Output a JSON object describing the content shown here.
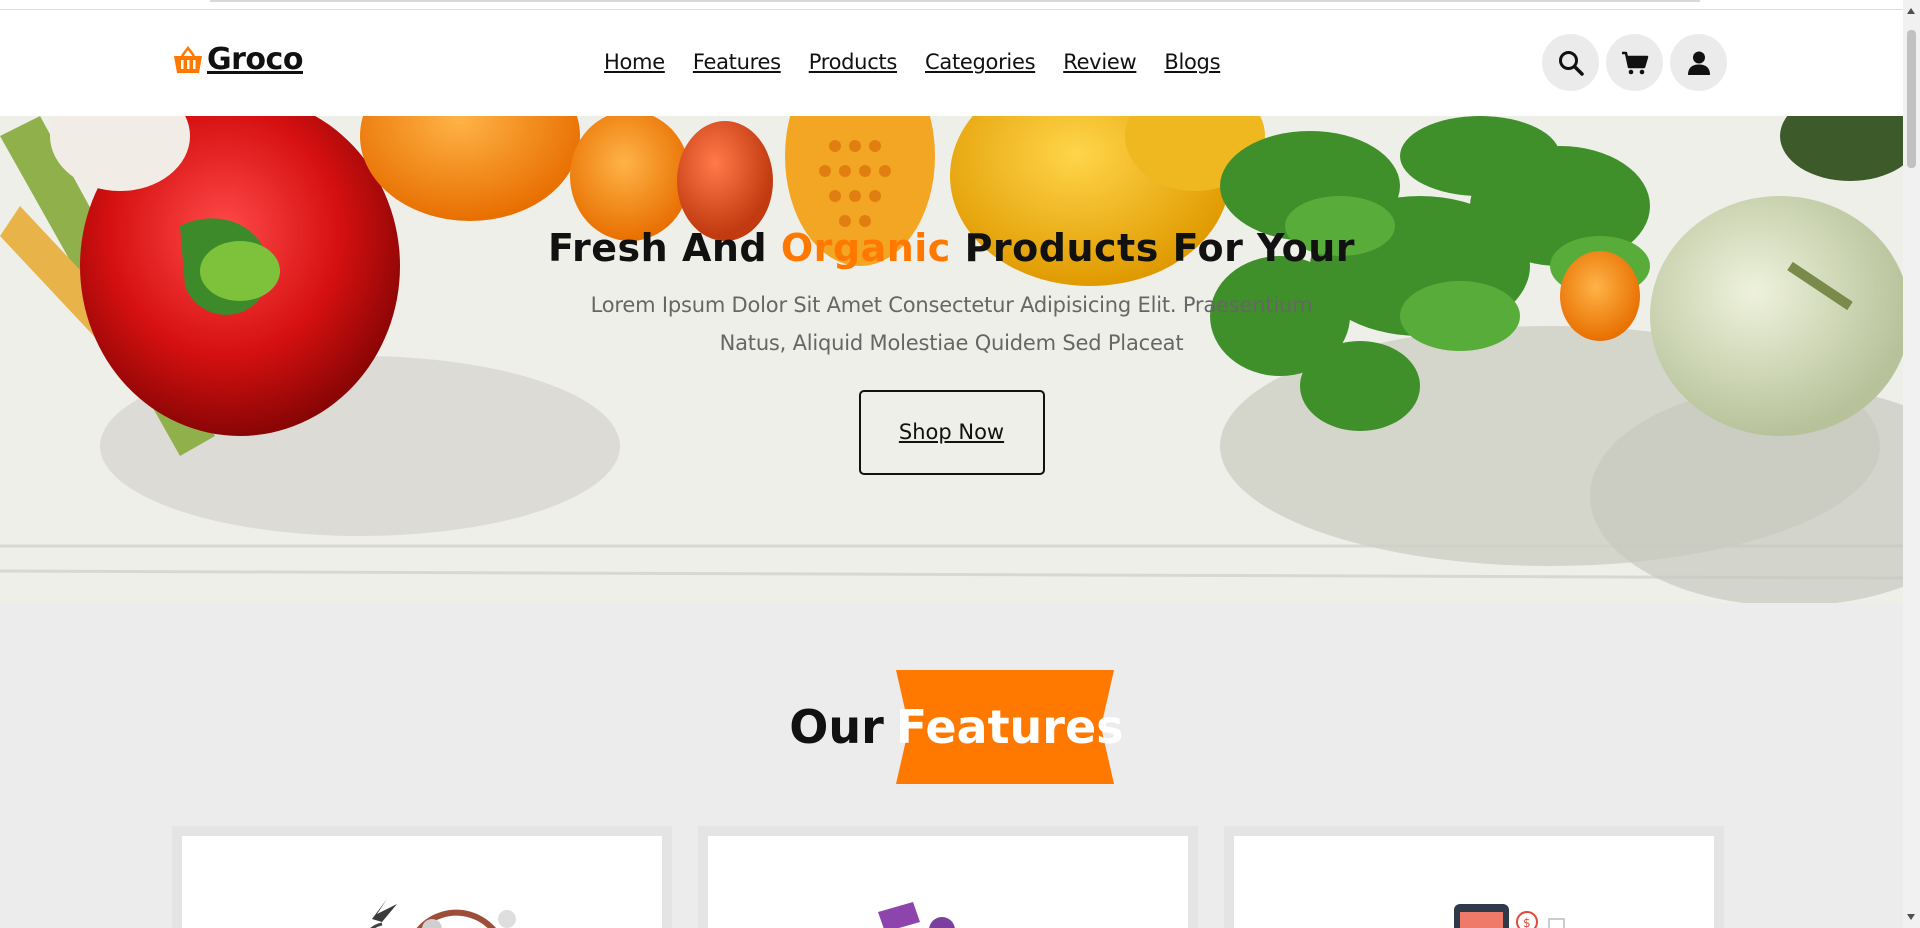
{
  "brand": {
    "name": "Groco",
    "accent": "#ff7800"
  },
  "nav": {
    "items": [
      "Home",
      "Features",
      "Products",
      "Categories",
      "Review",
      "Blogs"
    ]
  },
  "header_icons": [
    "search-icon",
    "cart-icon",
    "user-icon"
  ],
  "hero": {
    "title_before": "Fresh And ",
    "title_accent": "Organic",
    "title_after": " Products For Your",
    "description": "Lorem Ipsum Dolor Sit Amet Consectetur Adipisicing Elit. Praesentium Natus, Aliquid Molestiae Quidem Sed Placeat",
    "button": "Shop Now"
  },
  "features": {
    "heading_prefix": "Our",
    "heading_highlight": "Features"
  }
}
